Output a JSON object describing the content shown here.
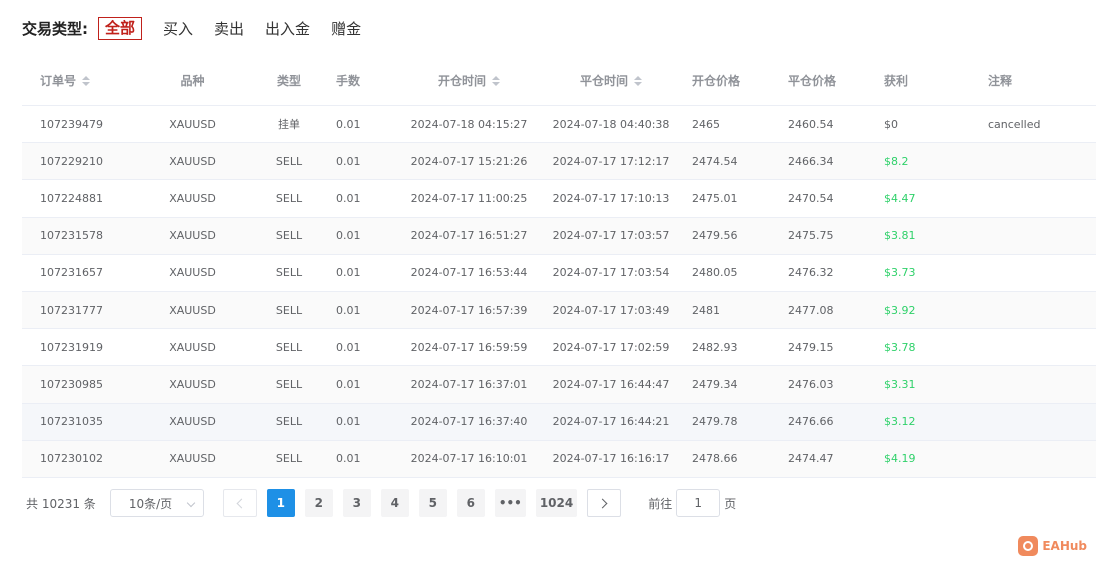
{
  "filter": {
    "label": "交易类型:",
    "options": [
      "全部",
      "买入",
      "卖出",
      "出入金",
      "赠金"
    ],
    "active_index": 0
  },
  "table": {
    "headers": [
      "订单号",
      "品种",
      "类型",
      "手数",
      "开仓时间",
      "平仓时间",
      "开仓价格",
      "平仓价格",
      "获利",
      "注释"
    ],
    "sortable_columns": [
      0,
      4,
      5
    ],
    "rows": [
      [
        "107239479",
        "XAUUSD",
        "挂单",
        "0.01",
        "2024-07-18 04:15:27",
        "2024-07-18 04:40:38",
        "2465",
        "2460.54",
        "$0",
        "cancelled"
      ],
      [
        "107229210",
        "XAUUSD",
        "SELL",
        "0.01",
        "2024-07-17 15:21:26",
        "2024-07-17 17:12:17",
        "2474.54",
        "2466.34",
        "$8.2",
        ""
      ],
      [
        "107224881",
        "XAUUSD",
        "SELL",
        "0.01",
        "2024-07-17 11:00:25",
        "2024-07-17 17:10:13",
        "2475.01",
        "2470.54",
        "$4.47",
        ""
      ],
      [
        "107231578",
        "XAUUSD",
        "SELL",
        "0.01",
        "2024-07-17 16:51:27",
        "2024-07-17 17:03:57",
        "2479.56",
        "2475.75",
        "$3.81",
        ""
      ],
      [
        "107231657",
        "XAUUSD",
        "SELL",
        "0.01",
        "2024-07-17 16:53:44",
        "2024-07-17 17:03:54",
        "2480.05",
        "2476.32",
        "$3.73",
        ""
      ],
      [
        "107231777",
        "XAUUSD",
        "SELL",
        "0.01",
        "2024-07-17 16:57:39",
        "2024-07-17 17:03:49",
        "2481",
        "2477.08",
        "$3.92",
        ""
      ],
      [
        "107231919",
        "XAUUSD",
        "SELL",
        "0.01",
        "2024-07-17 16:59:59",
        "2024-07-17 17:02:59",
        "2482.93",
        "2479.15",
        "$3.78",
        ""
      ],
      [
        "107230985",
        "XAUUSD",
        "SELL",
        "0.01",
        "2024-07-17 16:37:01",
        "2024-07-17 16:44:47",
        "2479.34",
        "2476.03",
        "$3.31",
        ""
      ],
      [
        "107231035",
        "XAUUSD",
        "SELL",
        "0.01",
        "2024-07-17 16:37:40",
        "2024-07-17 16:44:21",
        "2479.78",
        "2476.66",
        "$3.12",
        ""
      ],
      [
        "107230102",
        "XAUUSD",
        "SELL",
        "0.01",
        "2024-07-17 16:10:01",
        "2024-07-17 16:16:17",
        "2478.66",
        "2474.47",
        "$4.19",
        ""
      ]
    ],
    "hover_row": 8
  },
  "pagination": {
    "total": "共 10231 条",
    "page_size": "10条/页",
    "pages": [
      "1",
      "2",
      "3",
      "4",
      "5",
      "6",
      "•••",
      "1024"
    ],
    "current": "1",
    "goto_prefix": "前往",
    "goto_value": "1",
    "goto_suffix": "页"
  },
  "brand": {
    "text": "EAHub"
  },
  "colors": {
    "active_filter": "#c0211b",
    "profit_positive": "#2fd16a",
    "page_active": "#1e90e6",
    "brand": "#f08a5d"
  }
}
